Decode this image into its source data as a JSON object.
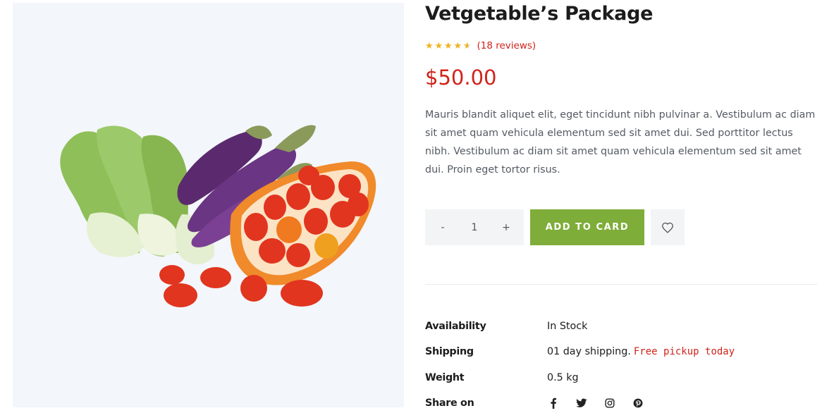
{
  "product": {
    "title": "Vetgetable’s Package",
    "rating_value": 4.5,
    "reviews_label": "(18 reviews)",
    "price": "$50.00",
    "description": "Mauris blandit aliquet elit, eget tincidunt nibh pulvinar a. Vestibulum ac diam sit amet quam vehicula elementum sed sit amet dui. Sed porttitor lectus nibh. Vestibulum ac diam sit amet quam vehicula elementum sed sit amet dui. Proin eget tortor risus."
  },
  "quantity": {
    "minus": "-",
    "value": "1",
    "plus": "+"
  },
  "actions": {
    "add_to_cart": "ADD TO CARD",
    "wishlist_icon": "heart-icon"
  },
  "specs": {
    "availability_label": "Availability",
    "availability_value": "In Stock",
    "shipping_label": "Shipping",
    "shipping_value": "01 day shipping.",
    "shipping_note": "Free pickup today",
    "weight_label": "Weight",
    "weight_value": "0.5 kg",
    "share_label": "Share on",
    "share_icons": [
      "facebook-icon",
      "twitter-icon",
      "instagram-icon",
      "pinterest-icon"
    ]
  },
  "colors": {
    "accent_green": "#7fad39",
    "price_red": "#d0231b",
    "star_gold": "#f0b21f"
  }
}
